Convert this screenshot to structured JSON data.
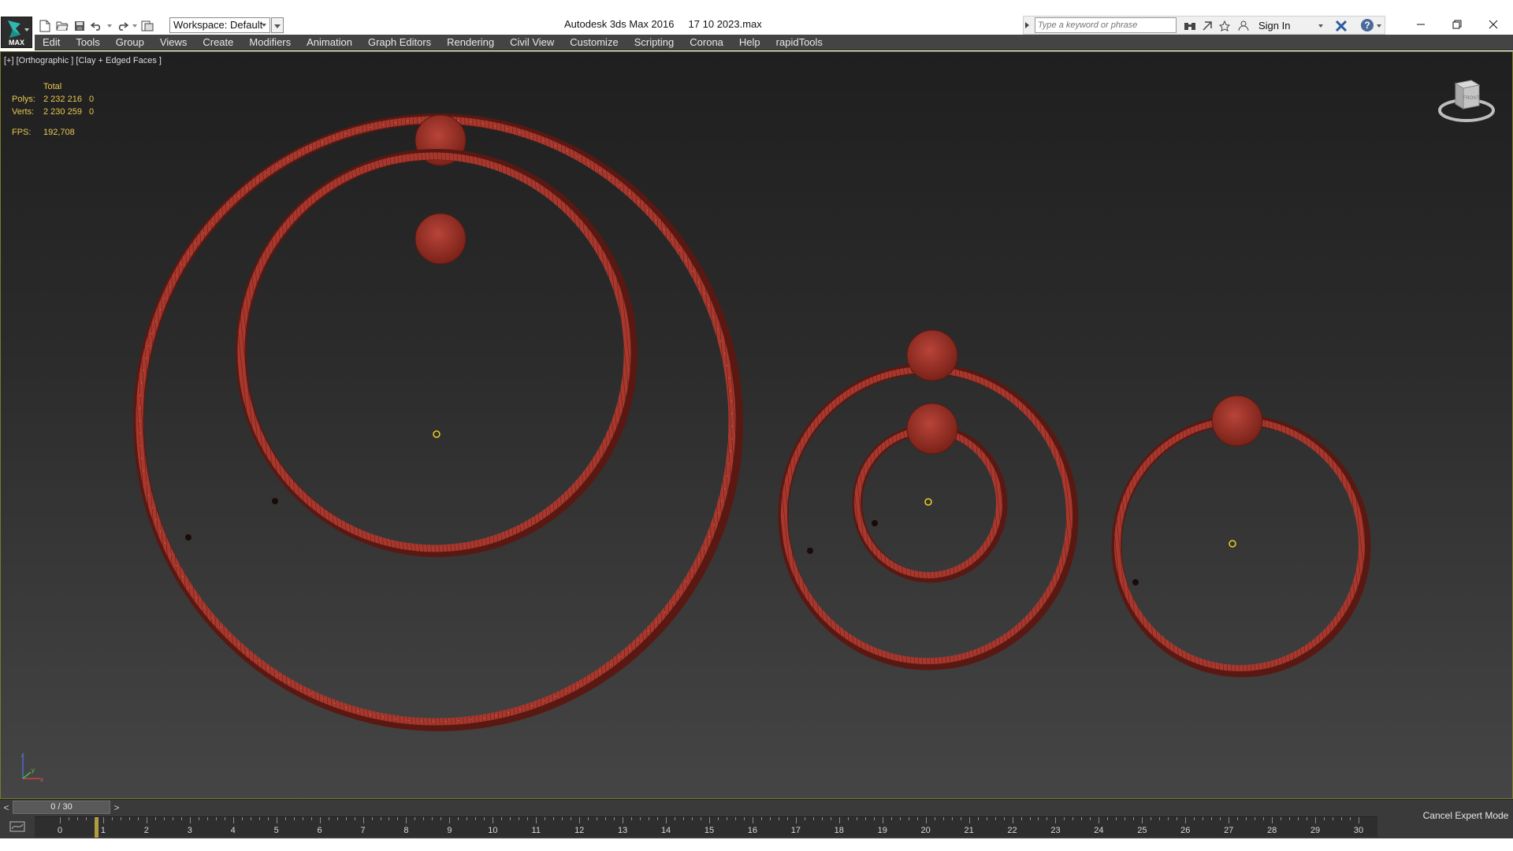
{
  "app": {
    "logo_label": "MAX",
    "title": "Autodesk 3ds Max 2016",
    "file_name": "17 10 2023.max"
  },
  "workspace": {
    "label": "Workspace: Default"
  },
  "infocenter": {
    "search_placeholder": "Type a keyword or phrase",
    "sign_in": "Sign In",
    "help": "?"
  },
  "menu": {
    "items": [
      "Edit",
      "Tools",
      "Group",
      "Views",
      "Create",
      "Modifiers",
      "Animation",
      "Graph Editors",
      "Rendering",
      "Civil View",
      "Customize",
      "Scripting",
      "Corona",
      "Help",
      "rapidTools"
    ]
  },
  "viewport": {
    "label": "[+] [Orthographic ] [Clay + Edged Faces ]",
    "stats": {
      "total_header": "Total",
      "polys_label": "Polys:",
      "polys_value": "2 232 216",
      "polys_selected": "0",
      "verts_label": "Verts:",
      "verts_value": "2 230 259",
      "verts_selected": "0",
      "fps_label": "FPS:",
      "fps_value": "192,708"
    },
    "axis": {
      "z": "z",
      "x": "x",
      "y": "y"
    },
    "viewcube_label": "FRONT"
  },
  "timeslider": {
    "prev": "<",
    "next": ">",
    "position": "0 / 30"
  },
  "trackbar": {
    "ticks": [
      "0",
      "1",
      "2",
      "3",
      "4",
      "5",
      "6",
      "7",
      "8",
      "9",
      "10",
      "11",
      "12",
      "13",
      "14",
      "15",
      "16",
      "17",
      "18",
      "19",
      "20",
      "21",
      "22",
      "23",
      "24",
      "25",
      "26",
      "27",
      "28",
      "29",
      "30"
    ]
  },
  "status": {
    "cancel_expert": "Cancel Expert Mode"
  },
  "colors": {
    "ring": "#b03a30",
    "ring_dark": "#6e1e18",
    "pivot": "#e8d020",
    "stats_text": "#e8c850"
  }
}
